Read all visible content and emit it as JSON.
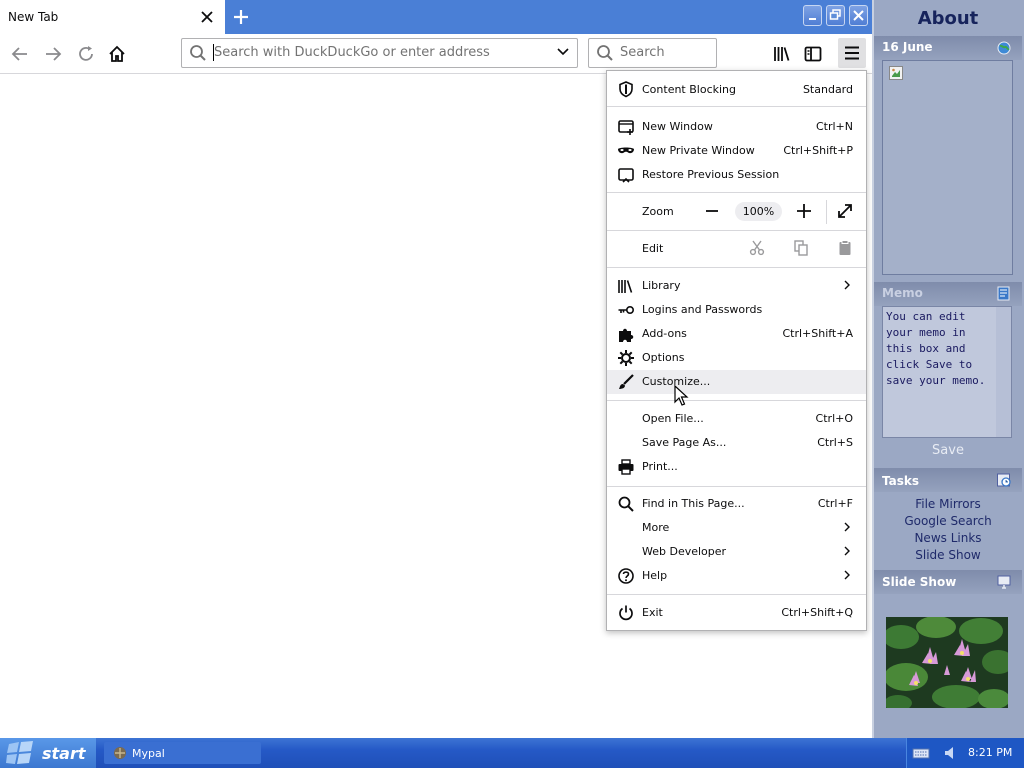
{
  "browser": {
    "tab_title": "New Tab",
    "url_placeholder": "Search with DuckDuckGo or enter address",
    "search_placeholder": "Search"
  },
  "menu": {
    "content_blocking": {
      "label": "Content Blocking",
      "value": "Standard"
    },
    "new_window": {
      "label": "New Window",
      "shortcut": "Ctrl+N"
    },
    "new_private_window": {
      "label": "New Private Window",
      "shortcut": "Ctrl+Shift+P"
    },
    "restore_session": {
      "label": "Restore Previous Session"
    },
    "zoom": {
      "label": "Zoom",
      "value": "100%"
    },
    "edit": {
      "label": "Edit"
    },
    "library": {
      "label": "Library"
    },
    "logins": {
      "label": "Logins and Passwords"
    },
    "addons": {
      "label": "Add-ons",
      "shortcut": "Ctrl+Shift+A"
    },
    "options": {
      "label": "Options"
    },
    "customize": {
      "label": "Customize..."
    },
    "open_file": {
      "label": "Open File...",
      "shortcut": "Ctrl+O"
    },
    "save_page": {
      "label": "Save Page As...",
      "shortcut": "Ctrl+S"
    },
    "print": {
      "label": "Print..."
    },
    "find": {
      "label": "Find in This Page...",
      "shortcut": "Ctrl+F"
    },
    "more": {
      "label": "More"
    },
    "web_developer": {
      "label": "Web Developer"
    },
    "help": {
      "label": "Help"
    },
    "exit": {
      "label": "Exit",
      "shortcut": "Ctrl+Shift+Q"
    }
  },
  "sidebar": {
    "title": "About",
    "date": "16 June",
    "memo_title": "Memo",
    "memo_text": "You can edit your memo in this box and click Save to save your memo.",
    "save_label": "Save",
    "tasks_title": "Tasks",
    "tasks": [
      "File Mirrors",
      "Google Search",
      "News Links",
      "Slide Show"
    ],
    "slideshow_title": "Slide Show"
  },
  "taskbar": {
    "start_label": "start",
    "task_label": "Mypal",
    "clock": "8:21 PM"
  },
  "icons": {
    "back": "arrow-left-icon",
    "forward": "arrow-right-icon",
    "reload": "reload-icon",
    "home": "home-icon",
    "library": "library-icon",
    "sidebar": "sidebar-icon",
    "menu": "hamburger-icon"
  },
  "colors": {
    "titlebar": "#4a7fd6",
    "sidebar": "#9ba8c4",
    "taskbar": "#2559c6"
  }
}
